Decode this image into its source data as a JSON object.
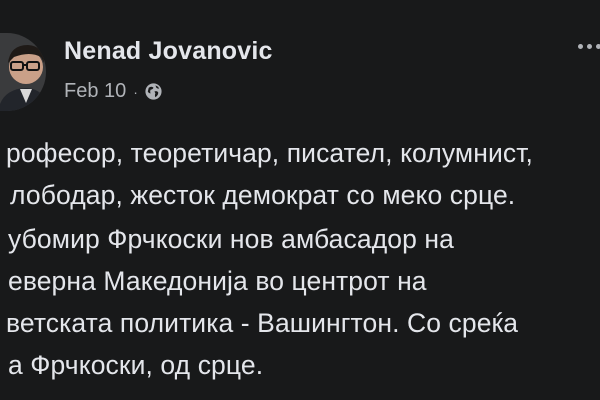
{
  "post": {
    "author": "Nenad Jovanovic",
    "date": "Feb 10",
    "separator": "·",
    "audience_icon": "globe-icon",
    "more_icon": "more-horizontal-icon",
    "lines": [
      "рофесор, теоретичар, писател, колумнист,",
      "лободар, жесток демократ со меко срце.",
      "убомир Фрчкоски нов амбасадор на",
      "еверна Македонија во центрот на",
      "ветската политика - Вашингтон. Со среќа",
      "а Фрчкоски, од срце."
    ]
  },
  "colors": {
    "background": "#18191a",
    "primary_text": "#e4e6eb",
    "secondary_text": "#b0b3b8"
  }
}
